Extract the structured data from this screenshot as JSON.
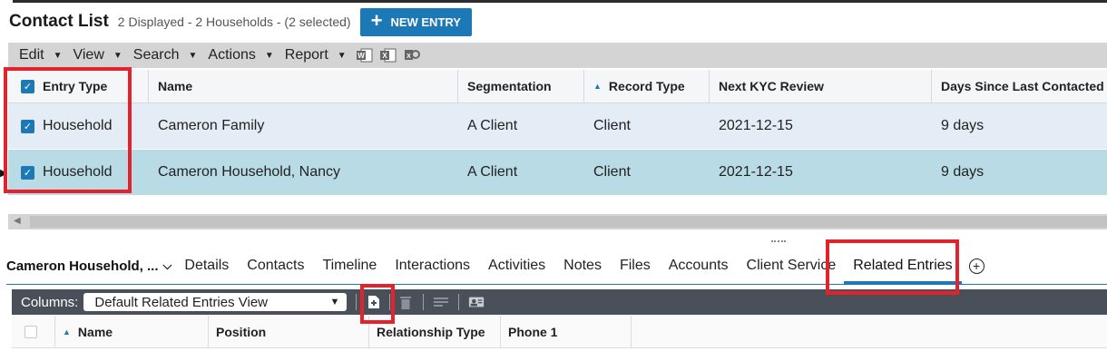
{
  "header": {
    "title": "Contact List",
    "subtitle": "2 Displayed - 2 Households - (2 selected)",
    "new_entry_label": "NEW ENTRY"
  },
  "menubar": {
    "items": [
      {
        "label": "Edit"
      },
      {
        "label": "View"
      },
      {
        "label": "Search"
      },
      {
        "label": "Actions"
      },
      {
        "label": "Report"
      }
    ],
    "export_icons": [
      "word-export-icon",
      "excel-export-icon",
      "excel-settings-icon"
    ]
  },
  "grid": {
    "columns": [
      "Entry Type",
      "Name",
      "Segmentation",
      "Record Type",
      "Next KYC Review",
      "Days Since Last Contacted"
    ],
    "rows": [
      {
        "entry_type": "Household",
        "name": "Cameron Family",
        "segmentation": "A Client",
        "record_type": "Client",
        "next_kyc": "2021-12-15",
        "days": "9 days",
        "selected": true
      },
      {
        "entry_type": "Household",
        "name": "Cameron Household, Nancy",
        "segmentation": "A Client",
        "record_type": "Client",
        "next_kyc": "2021-12-15",
        "days": "9 days",
        "selected": true
      }
    ]
  },
  "record": {
    "name": "Cameron Household, ..."
  },
  "tabs": [
    {
      "label": "Details"
    },
    {
      "label": "Contacts"
    },
    {
      "label": "Timeline"
    },
    {
      "label": "Interactions"
    },
    {
      "label": "Activities"
    },
    {
      "label": "Notes"
    },
    {
      "label": "Files"
    },
    {
      "label": "Accounts"
    },
    {
      "label": "Client Service"
    },
    {
      "label": "Related Entries",
      "active": true
    }
  ],
  "related": {
    "columns_label": "Columns:",
    "view_selected": "Default Related Entries View",
    "columns": [
      "Name",
      "Position",
      "Relationship Type",
      "Phone 1"
    ]
  },
  "colors": {
    "accent": "#1d78b6",
    "highlight_box": "#e3222b",
    "selected_row": "#b9dbe5"
  }
}
